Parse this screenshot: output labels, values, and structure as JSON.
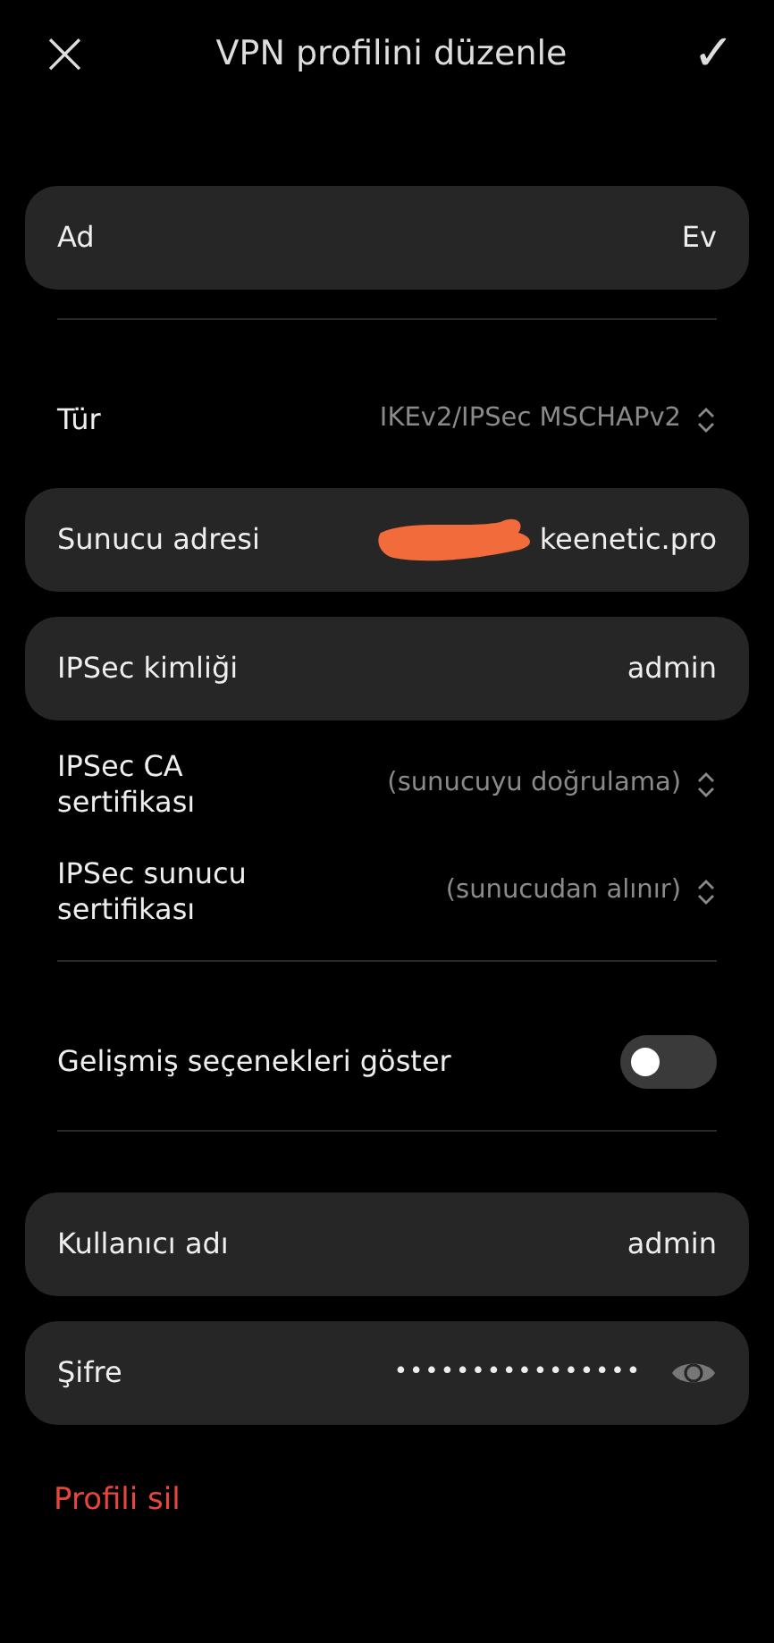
{
  "header": {
    "close": "×",
    "title": "VPN profilini düzenle",
    "confirm": "✓"
  },
  "rows": [
    {
      "kind": "field",
      "label": "Ad",
      "value": "Ev"
    },
    {
      "kind": "divider"
    },
    {
      "kind": "select",
      "label": "Tür",
      "value": "IKEv2/IPSec MSCHAPv2"
    },
    {
      "kind": "field",
      "label": "Sunucu adresi",
      "value": "keenetic.pro",
      "redacted": true
    },
    {
      "kind": "field",
      "label": "IPSec kimliği",
      "value": "admin"
    },
    {
      "kind": "select",
      "label": "IPSec CA sertifikası",
      "value": "(sunucuyu doğrulama)"
    },
    {
      "kind": "select",
      "label": "IPSec sunucu sertifikası",
      "value": "(sunucudan alınır)"
    },
    {
      "kind": "divider"
    },
    {
      "kind": "toggle",
      "label": "Gelişmiş seçenekleri göster",
      "on": false
    },
    {
      "kind": "divider"
    },
    {
      "kind": "field",
      "label": "Kullanıcı adı",
      "value": "admin"
    },
    {
      "kind": "password",
      "label": "Şifre",
      "value": "••••••••••••••••"
    }
  ],
  "delete_link": "Profili sil"
}
